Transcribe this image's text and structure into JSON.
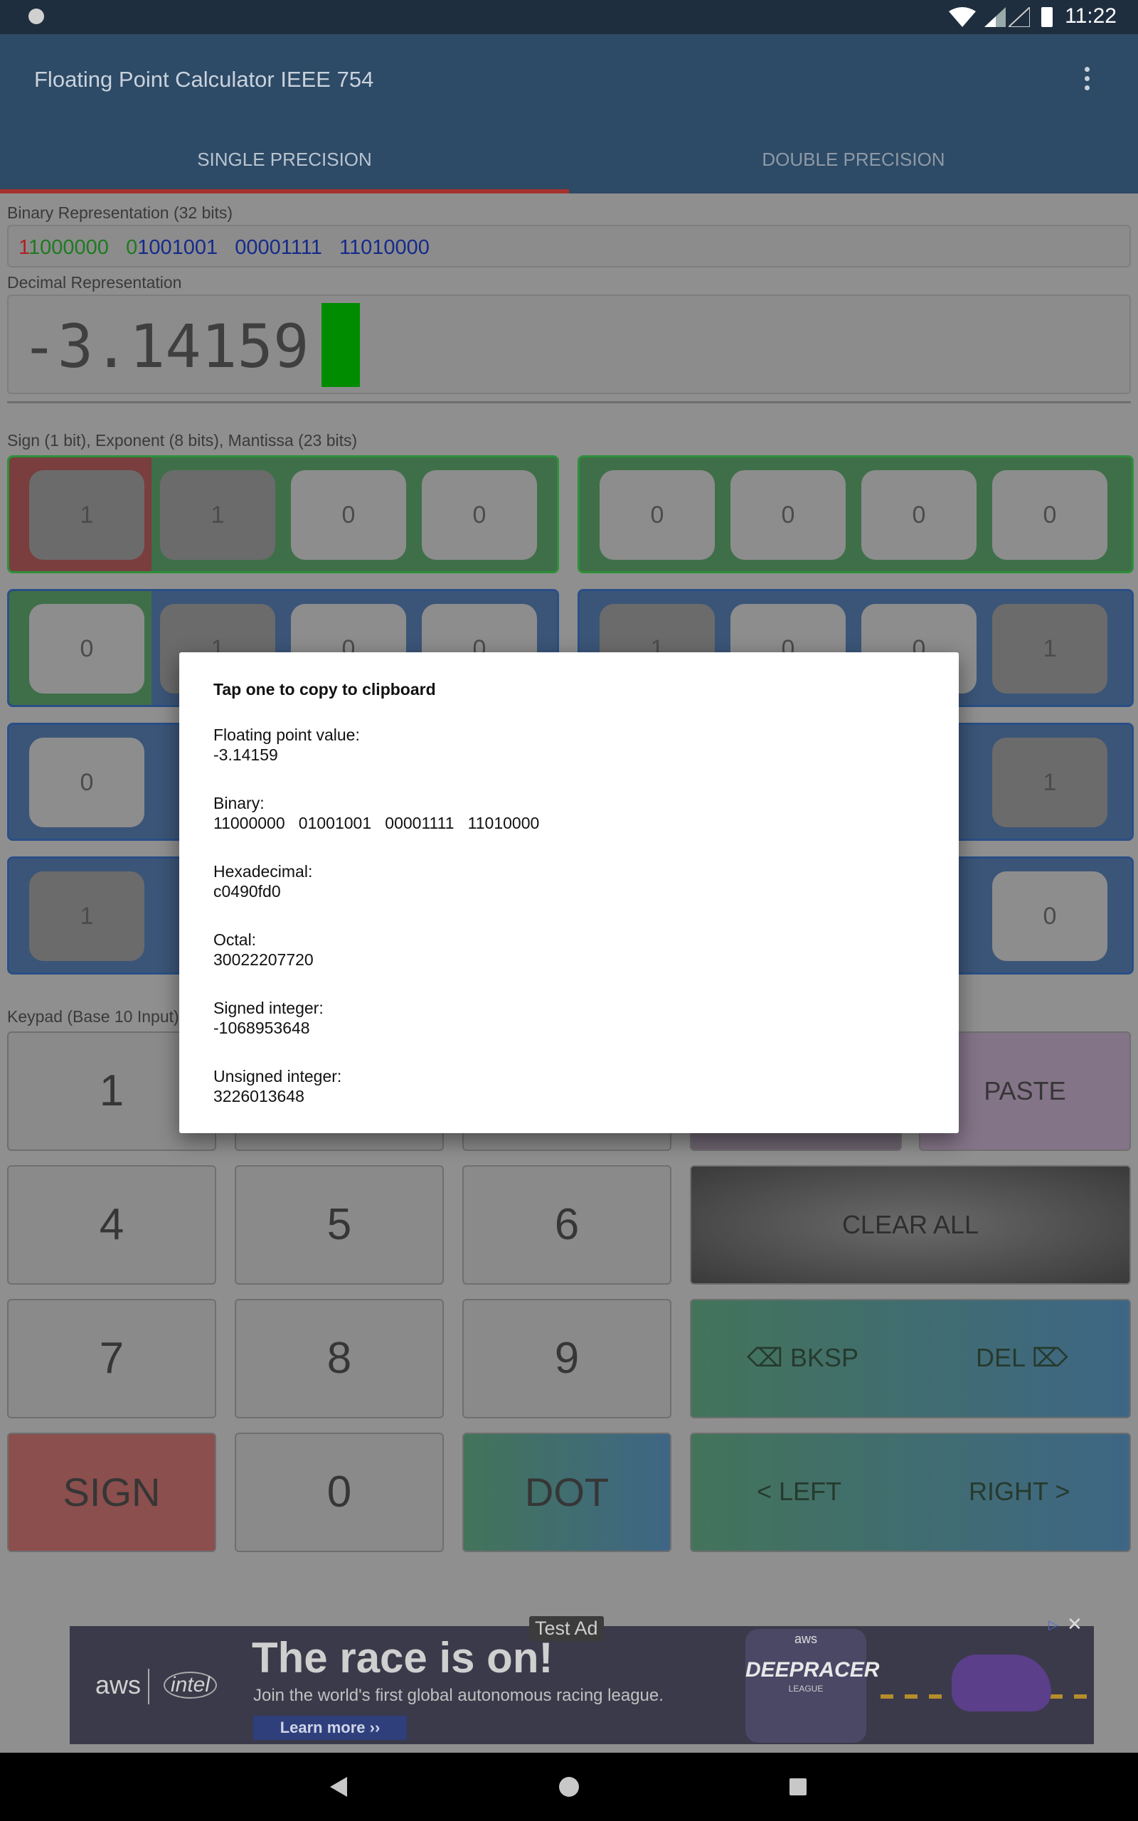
{
  "status": {
    "time": "11:22"
  },
  "app": {
    "title": "Floating Point Calculator IEEE 754",
    "menu_icon": "overflow-menu-icon"
  },
  "tabs": [
    {
      "label": "SINGLE PRECISION",
      "active": true
    },
    {
      "label": "DOUBLE PRECISION",
      "active": false
    }
  ],
  "binary": {
    "label": "Binary Representation (32 bits)",
    "sign": "1",
    "exp_a": "1000000",
    "exp_b": "0",
    "b1": "1001001",
    "b2": "00001111",
    "b3": "11010000"
  },
  "decimal": {
    "label": "Decimal Representation",
    "value": "-3.14159"
  },
  "bits": {
    "label": "Sign (1 bit), Exponent (8 bits), Mantissa (23 bits)",
    "row1_left": [
      "1",
      "1",
      "0",
      "0"
    ],
    "row1_right": [
      "0",
      "0",
      "0",
      "0"
    ],
    "row2_left": [
      "0",
      "1",
      "0",
      "0"
    ],
    "row2_right": [
      "1",
      "0",
      "0",
      "1"
    ],
    "row3_left": [
      "0"
    ],
    "row3_right": [
      "1"
    ],
    "row4_left": [
      "1"
    ],
    "row4_right": [
      "0"
    ]
  },
  "keypad": {
    "label": "Keypad (Base 10 Input)",
    "k1": "1",
    "k4": "4",
    "k5": "5",
    "k6": "6",
    "k7": "7",
    "k8": "8",
    "k9": "9",
    "k0": "0",
    "sign": "SIGN",
    "dot": "DOT",
    "paste": "PASTE",
    "clear": "CLEAR ALL",
    "bksp": "⌫ BKSP",
    "del": "DEL ⌦",
    "left": "< LEFT",
    "right": "RIGHT >"
  },
  "dialog": {
    "title": "Tap one to copy to clipboard",
    "items": [
      {
        "label": "Floating point value:",
        "value": "-3.14159"
      },
      {
        "label": "Binary:",
        "value": "11000000   01001001   00001111   11010000"
      },
      {
        "label": "Hexadecimal:",
        "value": "c0490fd0"
      },
      {
        "label": "Octal:",
        "value": "30022207720"
      },
      {
        "label": "Signed integer:",
        "value": "-1068953648"
      },
      {
        "label": "Unsigned integer:",
        "value": "3226013648"
      }
    ]
  },
  "ad": {
    "tag": "Test Ad",
    "headline": "The race is on!",
    "sub": "Join the world's first global autonomous racing league.",
    "cta": "Learn more ››",
    "brand1": "aws",
    "brand2": "intel",
    "logo": "DEEPRACER",
    "logo_top": "aws",
    "logo_bottom": "LEAGUE"
  },
  "colors": {
    "sign": "#c0352f",
    "exponent": "#2f8f3a",
    "mantissa": "#1f3aa0",
    "cursor": "#008c00"
  }
}
